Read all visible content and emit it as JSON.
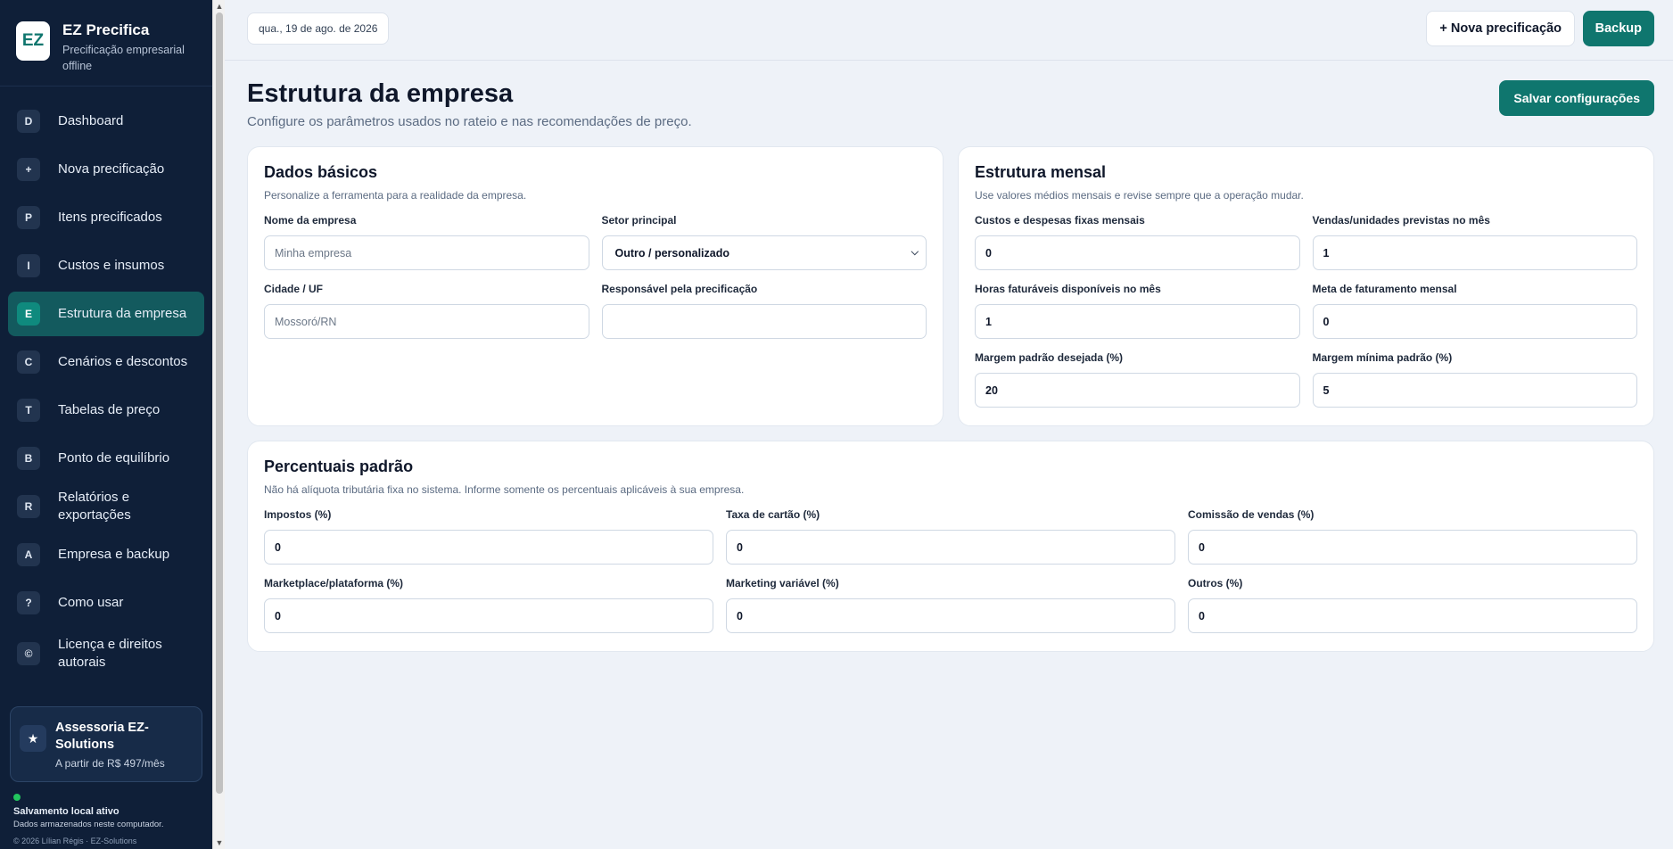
{
  "brand": {
    "logo": "EZ",
    "title": "EZ Precifica",
    "subtitle": "Precificação empresarial offline"
  },
  "nav": [
    {
      "key": "D",
      "label": "Dashboard"
    },
    {
      "key": "+",
      "label": "Nova precificação"
    },
    {
      "key": "P",
      "label": "Itens precificados"
    },
    {
      "key": "I",
      "label": "Custos e insumos"
    },
    {
      "key": "E",
      "label": "Estrutura da empresa",
      "active": true
    },
    {
      "key": "C",
      "label": "Cenários e descontos"
    },
    {
      "key": "T",
      "label": "Tabelas de preço"
    },
    {
      "key": "B",
      "label": "Ponto de equilíbrio"
    },
    {
      "key": "R",
      "label": "Relatórios e exportações"
    },
    {
      "key": "A",
      "label": "Empresa e backup"
    },
    {
      "key": "?",
      "label": "Como usar"
    },
    {
      "key": "©",
      "label": "Licença e direitos autorais"
    }
  ],
  "promo": {
    "icon": "★",
    "title": "Assessoria EZ-Solutions",
    "price": "A partir de R$ 497/mês"
  },
  "status": {
    "title": "Salvamento local ativo",
    "subtitle": "Dados armazenados neste computador.",
    "copyright": "© 2026 Lílian Régis · EZ-Solutions"
  },
  "topbar": {
    "date": "qua., 19 de ago. de 2026",
    "new_button": "+ Nova precificação",
    "backup_button": "Backup"
  },
  "page": {
    "title": "Estrutura da empresa",
    "subtitle": "Configure os parâmetros usados no rateio e nas recomendações de preço.",
    "save_button": "Salvar configurações"
  },
  "basic": {
    "title": "Dados básicos",
    "subtitle": "Personalize a ferramenta para a realidade da empresa.",
    "company_label": "Nome da empresa",
    "company_placeholder": "Minha empresa",
    "sector_label": "Setor principal",
    "sector_value": "Outro / personalizado",
    "city_label": "Cidade / UF",
    "city_placeholder": "Mossoró/RN",
    "responsible_label": "Responsável pela precificação",
    "responsible_value": ""
  },
  "monthly": {
    "title": "Estrutura mensal",
    "subtitle": "Use valores médios mensais e revise sempre que a operação mudar.",
    "fixed_label": "Custos e despesas fixas mensais",
    "fixed_value": "0",
    "sales_label": "Vendas/unidades previstas no mês",
    "sales_value": "1",
    "hours_label": "Horas faturáveis disponíveis no mês",
    "hours_value": "1",
    "revenue_label": "Meta de faturamento mensal",
    "revenue_value": "0",
    "margin_label": "Margem padrão desejada (%)",
    "margin_value": "20",
    "min_margin_label": "Margem mínima padrão (%)",
    "min_margin_value": "5"
  },
  "percent": {
    "title": "Percentuais padrão",
    "subtitle": "Não há alíquota tributária fixa no sistema. Informe somente os percentuais aplicáveis à sua empresa.",
    "taxes_label": "Impostos (%)",
    "taxes_value": "0",
    "card_label": "Taxa de cartão (%)",
    "card_value": "0",
    "commission_label": "Comissão de vendas (%)",
    "commission_value": "0",
    "marketplace_label": "Marketplace/plataforma (%)",
    "marketplace_value": "0",
    "marketing_label": "Marketing variável (%)",
    "marketing_value": "0",
    "others_label": "Outros (%)",
    "others_value": "0"
  }
}
